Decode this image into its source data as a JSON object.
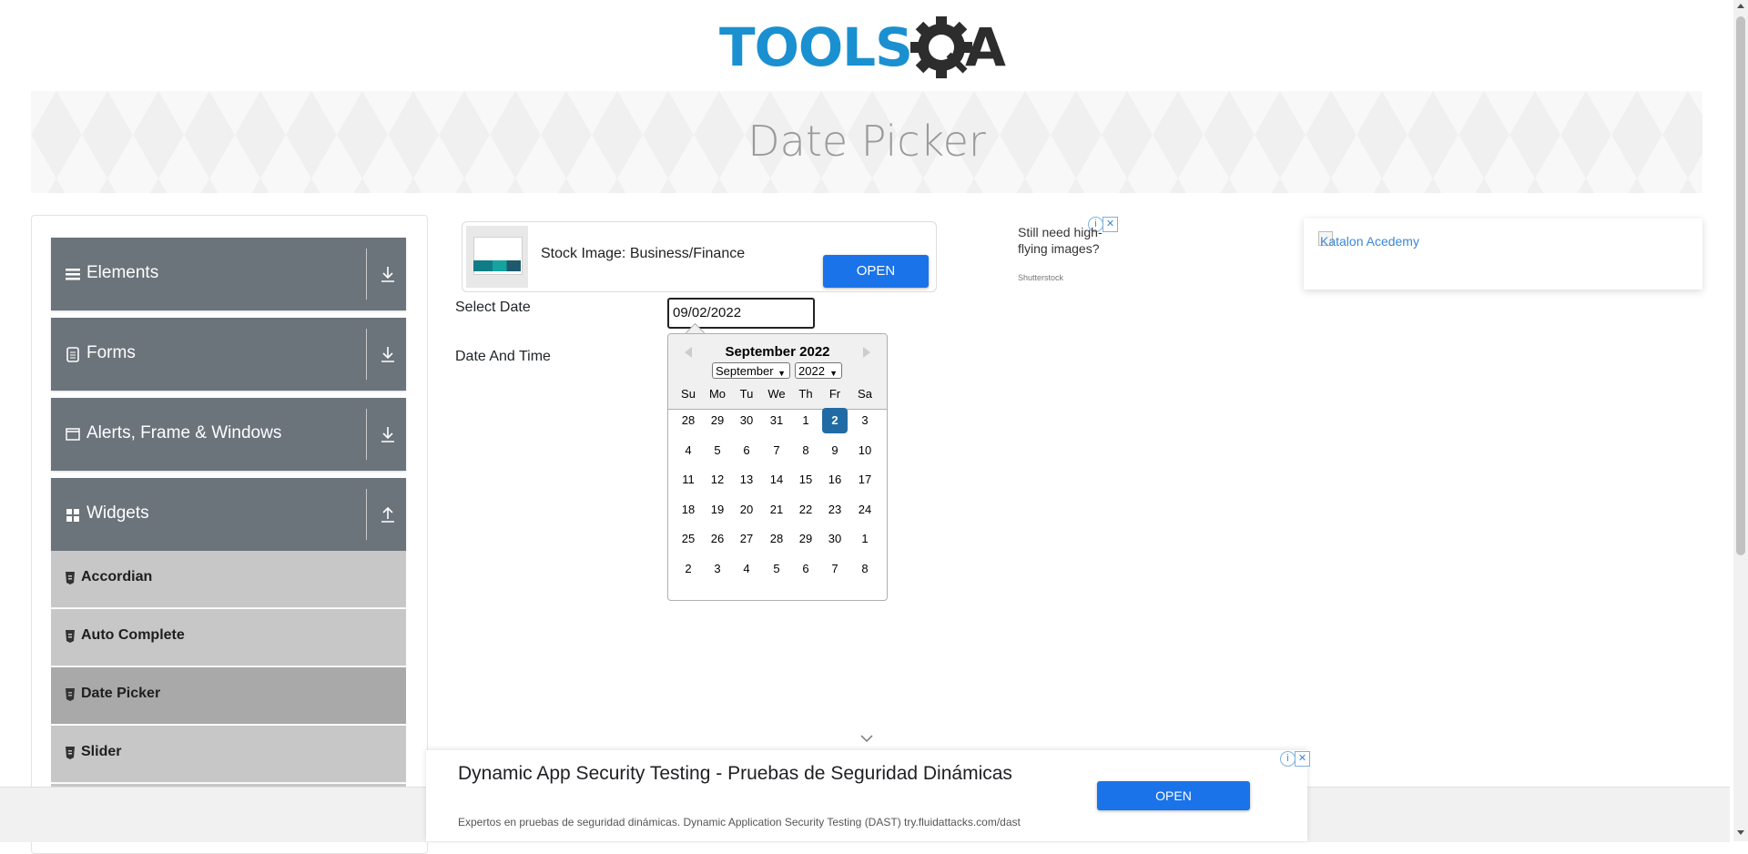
{
  "header": {
    "logo_text": "TOOLS",
    "logo_qa": "QA"
  },
  "banner": {
    "title": "Date Picker"
  },
  "sidebar": {
    "groups": [
      {
        "label": "Elements",
        "icon": "hamburger-icon",
        "toggle": "download-icon"
      },
      {
        "label": "Forms",
        "icon": "form-icon",
        "toggle": "download-icon"
      },
      {
        "label": "Alerts, Frame & Windows",
        "icon": "window-icon",
        "toggle": "download-icon"
      },
      {
        "label": "Widgets",
        "icon": "widgets-icon",
        "toggle": "upload-icon"
      }
    ],
    "items": [
      {
        "label": "Accordian",
        "active": false
      },
      {
        "label": "Auto Complete",
        "active": false
      },
      {
        "label": "Date Picker",
        "active": true
      },
      {
        "label": "Slider",
        "active": false
      }
    ]
  },
  "ads": {
    "top": {
      "text": "Stock Image: Business/Finance",
      "button": "OPEN"
    },
    "small": {
      "text": "Still need high-flying images?",
      "source": "Shutterstock"
    },
    "right": {
      "alt": "Katalon Acedemy"
    },
    "bottom": {
      "headline": "Dynamic App Security Testing - Pruebas de Seguridad Dinámicas",
      "description": "Expertos en pruebas de seguridad dinámicas. Dynamic Application Security Testing (DAST) try.fluidattacks.com/dast",
      "button": "OPEN"
    }
  },
  "form": {
    "select_date_label": "Select Date",
    "date_time_label": "Date And Time",
    "date_value": "09/02/2022"
  },
  "calendar": {
    "title": "September 2022",
    "month_select": "September",
    "year_select": "2022",
    "weekdays": [
      "Su",
      "Mo",
      "Tu",
      "We",
      "Th",
      "Fr",
      "Sa"
    ],
    "weeks": [
      [
        "28",
        "29",
        "30",
        "31",
        "1",
        "2",
        "3"
      ],
      [
        "4",
        "5",
        "6",
        "7",
        "8",
        "9",
        "10"
      ],
      [
        "11",
        "12",
        "13",
        "14",
        "15",
        "16",
        "17"
      ],
      [
        "18",
        "19",
        "20",
        "21",
        "22",
        "23",
        "24"
      ],
      [
        "25",
        "26",
        "27",
        "28",
        "29",
        "30",
        "1"
      ],
      [
        "2",
        "3",
        "4",
        "5",
        "6",
        "7",
        "8"
      ]
    ],
    "selected_day": "2",
    "colors": {
      "selected": "#216ba5"
    }
  },
  "colors": {
    "sidebar_group": "#6b737b",
    "sidebar_item": "#c7c7c7",
    "sidebar_active": "#a9a9a9",
    "button": "#1a73e8",
    "logo_blue": "#1a90d0"
  }
}
